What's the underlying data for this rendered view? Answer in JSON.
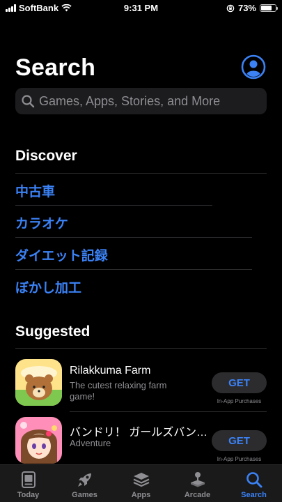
{
  "status_bar": {
    "carrier": "SoftBank",
    "time": "9:31 PM",
    "battery": "73%",
    "battery_level": 0.73
  },
  "header": {
    "title": "Search",
    "account_icon": "person-circle-icon"
  },
  "search": {
    "placeholder": "Games, Apps, Stories, and More"
  },
  "discover": {
    "title": "Discover",
    "items": [
      "中古車",
      "カラオケ",
      "ダイエット記録",
      "ぼかし加工"
    ]
  },
  "suggested": {
    "title": "Suggested",
    "apps": [
      {
        "name": "Rilakkuma Farm",
        "subtitle": "The cutest relaxing farm game!",
        "button": "GET",
        "note": "In-App Purchases"
      },
      {
        "name": "バンドリ！ ガールズバン…",
        "subtitle": "Adventure",
        "button": "GET",
        "note": "In-App Purchases"
      }
    ]
  },
  "tabs": [
    {
      "label": "Today",
      "icon": "today-icon"
    },
    {
      "label": "Games",
      "icon": "rocket-icon"
    },
    {
      "label": "Apps",
      "icon": "layers-icon"
    },
    {
      "label": "Arcade",
      "icon": "joystick-icon"
    },
    {
      "label": "Search",
      "icon": "search-icon",
      "active": true
    }
  ],
  "colors": {
    "accent": "#3b82f6",
    "background": "#000000",
    "secondary_text": "#8e8e93"
  }
}
